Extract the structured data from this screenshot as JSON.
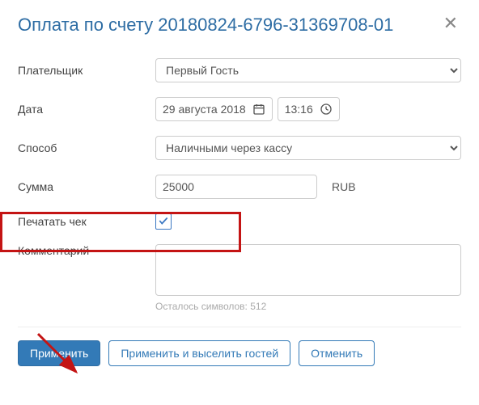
{
  "header": {
    "title": "Оплата по счету 20180824-6796-31369708-01"
  },
  "form": {
    "payer_label": "Плательщик",
    "payer_value": "Первый Гость",
    "date_label": "Дата",
    "date_value": "29 августа 2018",
    "time_value": "13:16",
    "method_label": "Способ",
    "method_value": "Наличными через кассу",
    "amount_label": "Сумма",
    "amount_value": "25000",
    "currency": "RUB",
    "print_check_label": "Печатать чек",
    "print_check_checked": true,
    "comment_label": "Комментарий",
    "char_count_text": "Осталось символов: 512"
  },
  "buttons": {
    "apply": "Применить",
    "apply_checkout": "Применить и выселить гостей",
    "cancel": "Отменить"
  }
}
